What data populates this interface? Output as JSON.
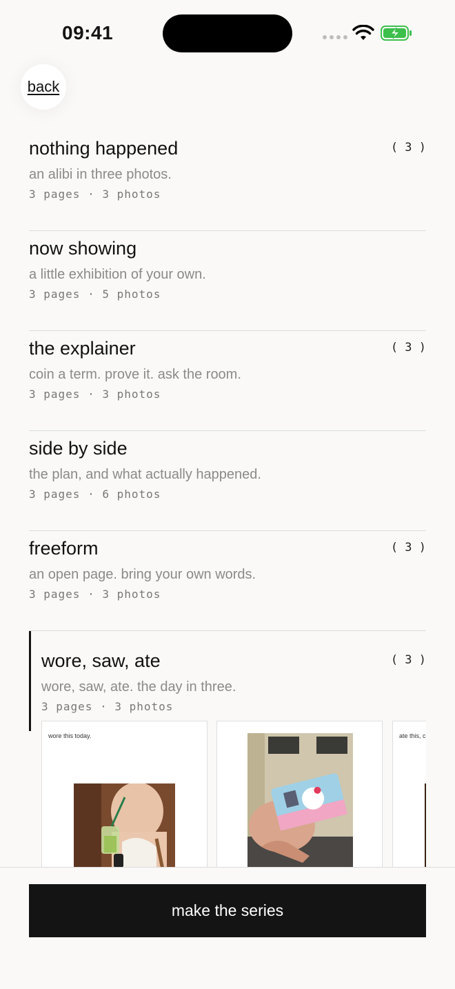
{
  "status": {
    "time": "09:41",
    "battery_color": "#3dbf4c"
  },
  "nav": {
    "back_label": "back"
  },
  "series": [
    {
      "title": "nothing happened",
      "description": "an alibi in three photos.",
      "meta": "3 pages · 3 photos",
      "count": "( 3 )"
    },
    {
      "title": "now showing",
      "description": "a little exhibition of your own.",
      "meta": "3 pages · 5 photos",
      "count": ""
    },
    {
      "title": "the explainer",
      "description": "coin a term. prove it. ask the room.",
      "meta": "3 pages · 3 photos",
      "count": "( 3 )"
    },
    {
      "title": "side by side",
      "description": "the plan, and what actually happened.",
      "meta": "3 pages · 6 photos",
      "count": ""
    },
    {
      "title": "freeform",
      "description": "an open page. bring your own words.",
      "meta": "3 pages · 3 photos",
      "count": "( 3 )"
    },
    {
      "title": "wore, saw, ate",
      "description": "wore, saw, ate. the day in three.",
      "meta": "3 pages · 3 photos",
      "count": "( 3 )",
      "selected": true
    }
  ],
  "preview_pages": [
    {
      "caption": "wore this today.",
      "photo": "person holding matcha drink"
    },
    {
      "caption": "",
      "photo": "hand holding hello kitty card on train"
    },
    {
      "caption": "ate this, c",
      "photo": "food photo"
    }
  ],
  "cta": {
    "label": "make the series"
  }
}
